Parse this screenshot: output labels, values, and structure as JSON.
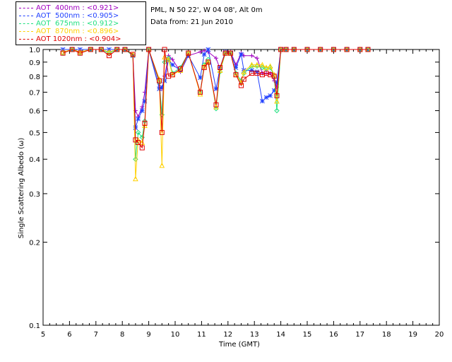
{
  "header": {
    "site_line": "PML, N 50 22', W 04 08', Alt 0m",
    "date_line": "Data from: 21 Jun 2010"
  },
  "legend": [
    {
      "label": "AOT  400nm : <0.921>",
      "color": "#a000c0"
    },
    {
      "label": "AOT  500nm : <0.905>",
      "color": "#1f3fff"
    },
    {
      "label": "AOT  675nm : <0.912>",
      "color": "#20e080"
    },
    {
      "label": "AOT  870nm : <0.896>",
      "color": "#ffd000"
    },
    {
      "label": "AOT 1020nm : <0.904>",
      "color": "#e00000"
    }
  ],
  "chart_data": {
    "type": "scatter",
    "xlabel": "Time (GMT)",
    "ylabel": "Single Scattering Albedo (ω)",
    "xlim": [
      5,
      20
    ],
    "ylim": [
      0.1,
      1.0
    ],
    "yscale": "log",
    "x_ticks": [
      5,
      6,
      7,
      8,
      9,
      10,
      11,
      12,
      13,
      14,
      15,
      16,
      17,
      18,
      19,
      20
    ],
    "y_ticks": [
      0.1,
      0.2,
      0.3,
      0.4,
      0.5,
      0.6,
      0.7,
      0.8,
      0.9,
      1.0
    ],
    "y_tick_labels": [
      "0.1",
      "0.2",
      "0.3",
      "0.4",
      "0.5",
      "0.6",
      "0.7",
      "0.8",
      "0.9",
      "1.0"
    ],
    "series": [
      {
        "name": "AOT  400nm : <0.921>",
        "color": "#a000c0",
        "marker": "plus",
        "x": [
          5.75,
          6.1,
          6.4,
          6.8,
          7.2,
          7.5,
          7.8,
          8.1,
          8.4,
          8.5,
          8.6,
          8.75,
          8.85,
          9.0,
          9.4,
          9.5,
          9.6,
          9.75,
          9.9,
          10.2,
          10.5,
          10.95,
          11.1,
          11.25,
          11.55,
          11.7,
          11.9,
          12.1,
          12.3,
          12.5,
          12.6,
          12.9,
          13.1,
          13.3,
          13.45,
          13.6,
          13.75,
          13.85,
          14.0,
          14.2,
          14.5,
          15.0,
          15.5,
          16.0,
          16.5,
          17.0,
          17.3
        ],
        "y": [
          1.0,
          1.0,
          1.0,
          1.0,
          1.0,
          1.0,
          1.0,
          1.0,
          0.95,
          0.6,
          0.57,
          0.62,
          0.7,
          1.0,
          0.73,
          0.72,
          0.8,
          0.95,
          0.92,
          0.83,
          0.95,
          0.98,
          0.99,
          0.98,
          0.93,
          0.85,
          0.98,
          0.98,
          0.88,
          0.97,
          0.95,
          0.95,
          0.93,
          0.82,
          0.82,
          0.82,
          0.77,
          0.73,
          1.0,
          1.0,
          1.0,
          1.0,
          1.0,
          1.0,
          1.0,
          1.0,
          1.0
        ]
      },
      {
        "name": "AOT  500nm : <0.905>",
        "color": "#1f3fff",
        "marker": "star",
        "x": [
          5.75,
          6.1,
          6.4,
          6.8,
          7.2,
          7.5,
          7.8,
          8.1,
          8.4,
          8.5,
          8.6,
          8.75,
          8.85,
          9.0,
          9.4,
          9.5,
          9.6,
          9.75,
          9.9,
          10.2,
          10.5,
          10.95,
          11.1,
          11.25,
          11.55,
          11.7,
          11.9,
          12.1,
          12.3,
          12.5,
          12.6,
          12.9,
          13.1,
          13.3,
          13.45,
          13.6,
          13.75,
          13.85,
          14.0,
          14.2,
          14.5,
          15.0,
          15.5,
          16.0,
          16.5,
          17.0,
          17.3
        ],
        "y": [
          1.0,
          1.0,
          1.0,
          1.0,
          1.0,
          1.0,
          1.0,
          1.0,
          0.95,
          0.52,
          0.56,
          0.6,
          0.65,
          1.0,
          0.72,
          0.73,
          0.77,
          0.92,
          0.88,
          0.84,
          0.95,
          0.79,
          0.96,
          1.0,
          0.72,
          0.86,
          0.98,
          0.97,
          0.86,
          0.96,
          0.84,
          0.84,
          0.83,
          0.65,
          0.67,
          0.68,
          0.71,
          0.76,
          1.0,
          1.0,
          1.0,
          1.0,
          1.0,
          1.0,
          1.0,
          1.0,
          1.0
        ]
      },
      {
        "name": "AOT  675nm : <0.912>",
        "color": "#20e080",
        "marker": "diamond",
        "x": [
          5.75,
          6.1,
          6.4,
          6.8,
          7.2,
          7.5,
          7.8,
          8.1,
          8.4,
          8.5,
          8.6,
          8.75,
          8.85,
          9.0,
          9.4,
          9.5,
          9.6,
          9.75,
          9.9,
          10.2,
          10.5,
          10.95,
          11.1,
          11.25,
          11.55,
          11.7,
          11.9,
          12.1,
          12.3,
          12.5,
          12.6,
          12.9,
          13.1,
          13.3,
          13.45,
          13.6,
          13.75,
          13.85,
          14.0,
          14.2,
          14.5,
          15.0,
          15.5,
          16.0,
          16.5,
          17.0,
          17.3
        ],
        "y": [
          0.97,
          1.0,
          0.97,
          1.0,
          1.0,
          0.97,
          1.0,
          1.0,
          0.95,
          0.4,
          0.5,
          0.48,
          0.55,
          1.0,
          0.76,
          0.58,
          0.9,
          0.93,
          0.82,
          0.86,
          0.97,
          0.7,
          0.88,
          0.92,
          0.61,
          0.83,
          0.97,
          0.97,
          0.82,
          0.77,
          0.82,
          0.87,
          0.87,
          0.86,
          0.85,
          0.86,
          0.8,
          0.6,
          1.0,
          1.0,
          1.0,
          1.0,
          1.0,
          1.0,
          1.0,
          1.0,
          1.0
        ]
      },
      {
        "name": "AOT  870nm : <0.896>",
        "color": "#ffd000",
        "marker": "triangle",
        "x": [
          5.75,
          6.1,
          6.4,
          6.8,
          7.2,
          7.5,
          7.8,
          8.1,
          8.4,
          8.5,
          8.6,
          8.75,
          8.85,
          9.0,
          9.4,
          9.5,
          9.6,
          9.75,
          9.9,
          10.2,
          10.5,
          10.95,
          11.1,
          11.25,
          11.55,
          11.7,
          11.9,
          12.1,
          12.3,
          12.5,
          12.6,
          12.9,
          13.1,
          13.3,
          13.45,
          13.6,
          13.75,
          13.85,
          14.0,
          14.2,
          14.5,
          15.0,
          15.5,
          16.0,
          16.5,
          17.0,
          17.3
        ],
        "y": [
          0.98,
          1.0,
          0.98,
          1.0,
          1.0,
          0.98,
          1.0,
          1.0,
          0.96,
          0.34,
          0.47,
          0.46,
          0.53,
          1.0,
          0.78,
          0.38,
          0.94,
          0.92,
          0.81,
          0.84,
          0.97,
          0.69,
          0.87,
          0.9,
          0.62,
          0.84,
          0.97,
          0.97,
          0.81,
          0.76,
          0.83,
          0.88,
          0.88,
          0.88,
          0.86,
          0.87,
          0.81,
          0.65,
          1.0,
          1.0,
          1.0,
          1.0,
          1.0,
          1.0,
          1.0,
          1.0,
          1.0
        ]
      },
      {
        "name": "AOT 1020nm : <0.904>",
        "color": "#e00000",
        "marker": "square",
        "x": [
          5.75,
          6.1,
          6.4,
          6.8,
          7.2,
          7.5,
          7.8,
          8.1,
          8.4,
          8.5,
          8.6,
          8.75,
          8.85,
          9.0,
          9.4,
          9.5,
          9.6,
          9.75,
          9.9,
          10.2,
          10.5,
          10.95,
          11.1,
          11.25,
          11.55,
          11.7,
          11.9,
          12.1,
          12.3,
          12.5,
          12.6,
          12.9,
          13.1,
          13.3,
          13.45,
          13.6,
          13.75,
          13.85,
          14.0,
          14.2,
          14.5,
          15.0,
          15.5,
          16.0,
          16.5,
          17.0,
          17.3
        ],
        "y": [
          0.97,
          1.0,
          0.97,
          1.0,
          1.0,
          0.95,
          1.0,
          1.0,
          0.96,
          0.47,
          0.46,
          0.44,
          0.54,
          1.0,
          0.77,
          0.5,
          1.0,
          0.8,
          0.81,
          0.85,
          0.97,
          0.7,
          0.86,
          0.9,
          0.63,
          0.86,
          0.97,
          0.97,
          0.81,
          0.74,
          0.78,
          0.82,
          0.82,
          0.81,
          0.82,
          0.81,
          0.8,
          0.68,
          1.0,
          1.0,
          1.0,
          1.0,
          1.0,
          1.0,
          1.0,
          1.0,
          1.0
        ]
      }
    ]
  }
}
